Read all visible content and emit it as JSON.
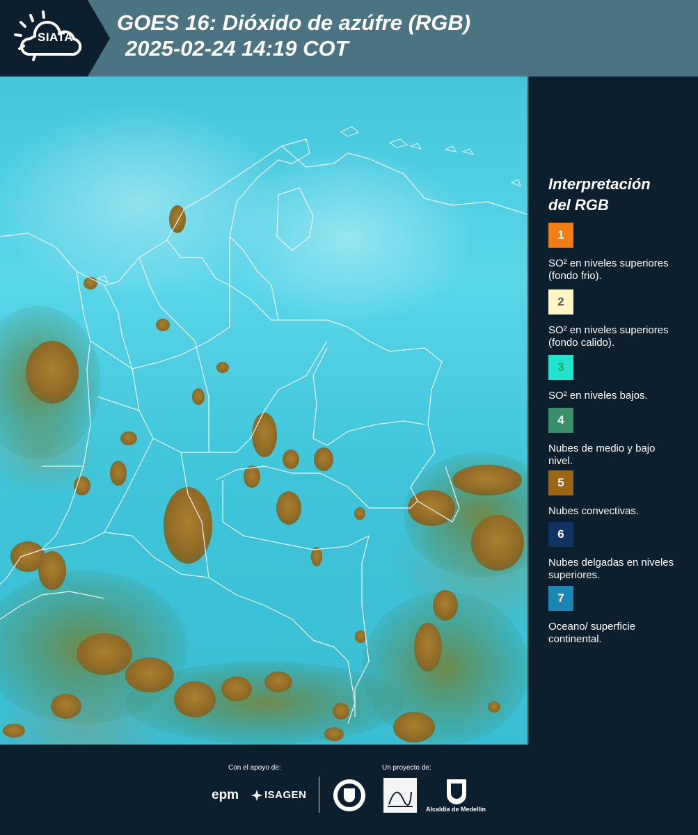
{
  "header": {
    "logo_text": "SIATA",
    "title_line1": "GOES 16: Dióxido de azúfre (RGB)",
    "title_line2": "2025-02-24 14:19 COT"
  },
  "legend": {
    "title_line1": "Interpretación",
    "title_line2": "del RGB",
    "items": [
      {
        "number": "1",
        "label": "SO² en niveles superiores (fondo frio).",
        "color": "#f07d15"
      },
      {
        "number": "2",
        "label": "SO² en niveles superiores (fondo calido).",
        "color": "#fff6c5"
      },
      {
        "number": "3",
        "label": "SO² en niveles bajos.",
        "color": "#22e3cf"
      },
      {
        "number": "4",
        "label": "Nubes de medio y bajo nivel.",
        "color": "#3b8f6a"
      },
      {
        "number": "5",
        "label": "Nubes convectivas.",
        "color": "#9a6516"
      },
      {
        "number": "6",
        "label": "Nubes delgadas en niveles superiores.",
        "color": "#0f3463"
      },
      {
        "number": "7",
        "label": "Oceano/ superficie continental.",
        "color": "#1b86b4"
      }
    ]
  },
  "footer": {
    "support_label": "Con el apoyo de:",
    "project_label": "Un proyecto de:",
    "epm_logo": "epm",
    "isagen_logo": "ISAGEN",
    "alcaldia_label": "Alcaldía de Medellín"
  },
  "colors": {
    "header_bg": "#4b7482",
    "panel_bg": "#0c1f2e",
    "convective_cloud": "#9a6c2a",
    "low_cloud": "#3b8f6a"
  }
}
